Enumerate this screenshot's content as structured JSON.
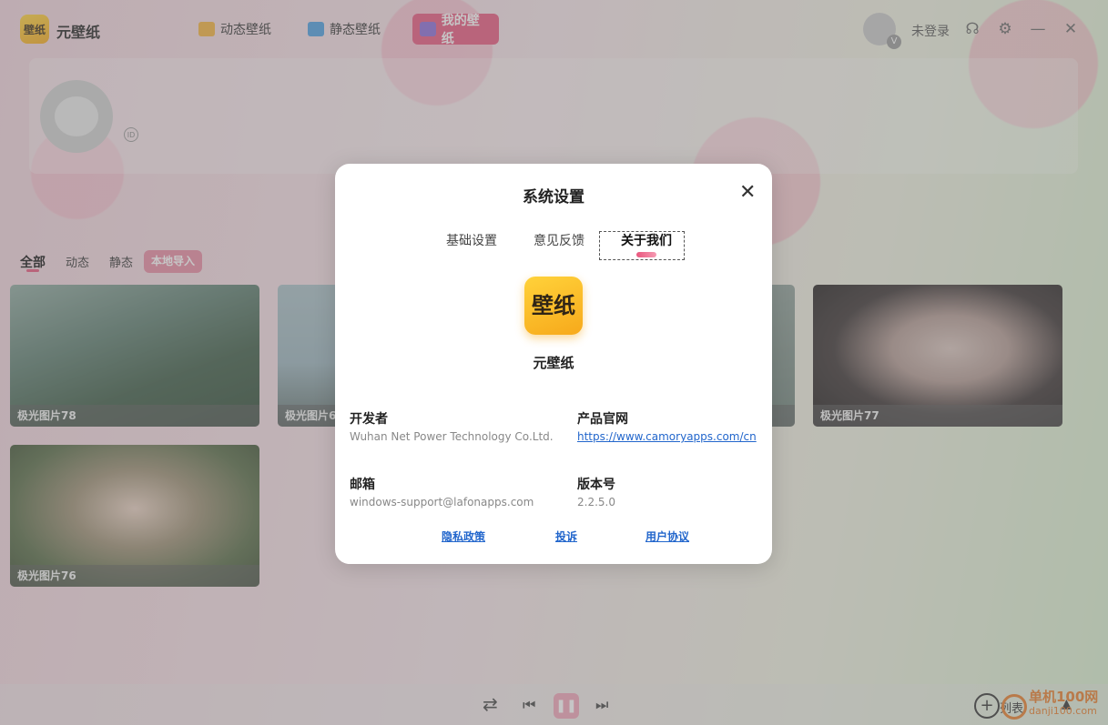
{
  "app": {
    "logo_text": "壁纸",
    "name": "元壁纸"
  },
  "nav": {
    "tabs": [
      {
        "label": "动态壁纸",
        "icon": "play-icon"
      },
      {
        "label": "静态壁纸",
        "icon": "image-icon"
      },
      {
        "label": "我的壁纸",
        "icon": "user-icon",
        "active": true
      }
    ]
  },
  "user": {
    "login_status": "未登录",
    "vip_badge": "V"
  },
  "profile": {
    "id_label": "ID"
  },
  "filters": {
    "items": [
      "全部",
      "动态",
      "静态"
    ],
    "active": "全部",
    "import_label": "本地导入"
  },
  "wallpapers": [
    {
      "caption": "极光图片78"
    },
    {
      "caption": "极光图片6"
    },
    {
      "caption": ""
    },
    {
      "caption": "极光图片77"
    },
    {
      "caption": "极光图片76"
    }
  ],
  "player": {
    "list_label": "列表"
  },
  "modal": {
    "title": "系统设置",
    "tabs": [
      "基础设置",
      "意见反馈",
      "关于我们"
    ],
    "active_tab": "关于我们",
    "about": {
      "logo_text": "壁纸",
      "app_name": "元壁纸",
      "developer_label": "开发者",
      "developer_value": "Wuhan Net Power Technology Co.Ltd.",
      "website_label": "产品官网",
      "website_value": "https://www.camoryapps.com/cn",
      "email_label": "邮箱",
      "email_value": "windows-support@lafonapps.com",
      "version_label": "版本号",
      "version_value": "2.2.5.0"
    },
    "footer_links": [
      "隐私政策",
      "投诉",
      "用户协议"
    ]
  },
  "watermark": {
    "line1": "单机100网",
    "line2": "danji100.com"
  },
  "colors": {
    "accent": "#e9577e",
    "link": "#2266cc",
    "logo": "#f7a91b"
  }
}
